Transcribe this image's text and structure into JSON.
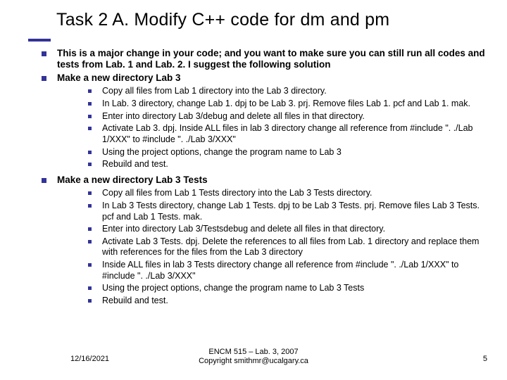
{
  "title": "Task 2 A. Modify C++ code for dm and pm",
  "bullets": {
    "b1": "This is a major change in your code; and you want to make sure you can still run all codes and tests from Lab. 1 and Lab. 2. I suggest the following solution",
    "b2": "Make a new directory Lab 3",
    "b2sub": {
      "s1": "Copy all files from Lab 1 directory into the Lab 3 directory.",
      "s2": "In Lab. 3 directory, change Lab 1. dpj to be Lab 3. prj. Remove files Lab 1. pcf and Lab 1. mak.",
      "s3": "Enter into directory Lab 3/debug and delete all files in that directory.",
      "s4": "Activate Lab 3. dpj. Inside ALL files in lab 3 directory change all reference from #include \". ./Lab 1/XXX\" to #include \". ./Lab 3/XXX\"",
      "s5": "Using the project options, change the program name to Lab 3",
      "s6": "Rebuild and test."
    },
    "b3": "Make a new directory  Lab 3 Tests",
    "b3sub": {
      "s1": "Copy all files from Lab 1 Tests directory into the Lab 3 Tests directory.",
      "s2": "In Lab 3 Tests directory, change Lab 1 Tests. dpj to be Lab 3 Tests. prj. Remove files Lab 3 Tests. pcf and Lab 1 Tests. mak.",
      "s3": "Enter into directory Lab 3/Testsdebug and delete all files in that directory.",
      "s4": "Activate Lab 3 Tests. dpj. Delete the references to all files from Lab. 1 directory and replace them with references for the files from the Lab 3 directory",
      "s5": "Inside ALL files in lab 3 Tests directory change all reference from   #include \". ./Lab 1/XXX\" to #include \". ./Lab 3/XXX\"",
      "s6": "Using the project options, change the program name to Lab 3 Tests",
      "s7": "Rebuild and test."
    }
  },
  "footer": {
    "date": "12/16/2021",
    "center1": "ENCM 515 – Lab. 3, 2007",
    "center2": "Copyright smithmr@ucalgary.ca",
    "page": "5"
  }
}
